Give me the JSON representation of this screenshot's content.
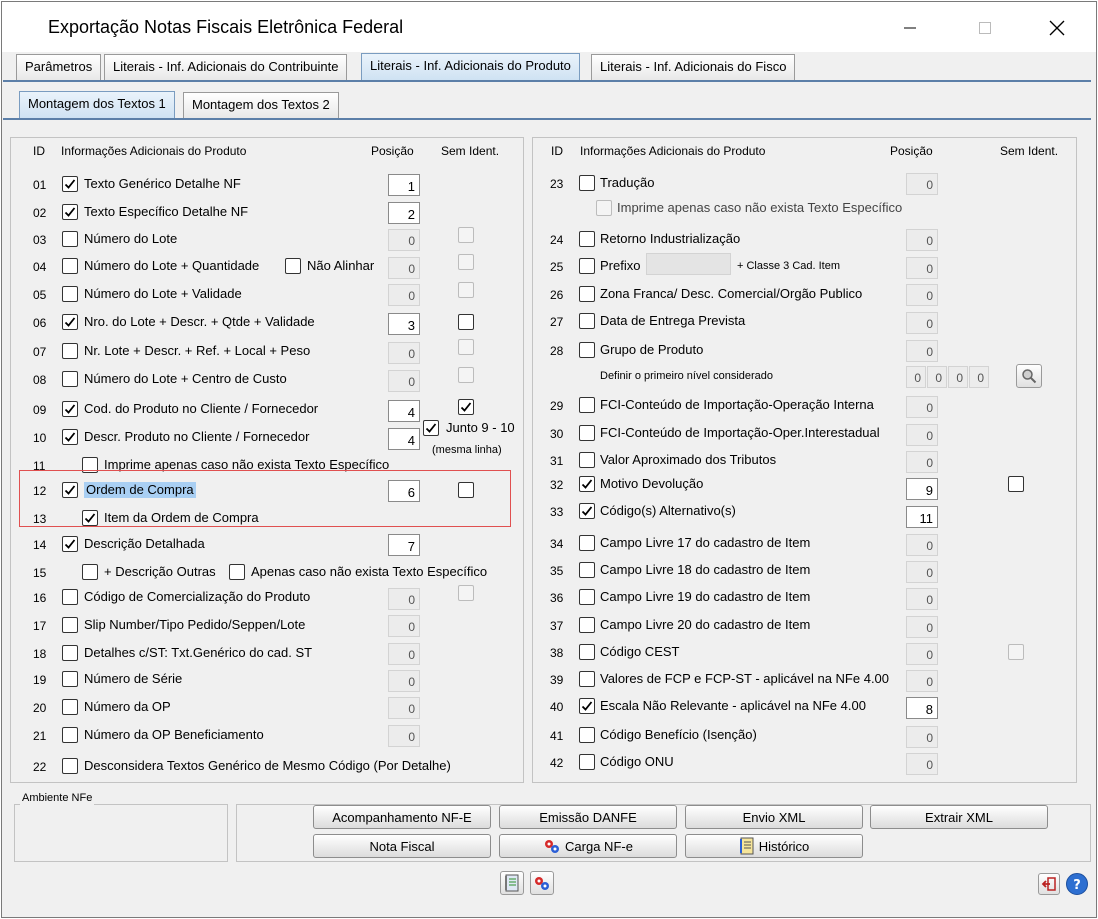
{
  "window": {
    "title": "Exportação Notas Fiscais Eletrônica Federal"
  },
  "tabs": [
    {
      "label": "Parâmetros",
      "active": false
    },
    {
      "label": "Literais - Inf. Adicionais do Contribuinte",
      "active": false
    },
    {
      "label": "Literais - Inf. Adicionais do Produto",
      "active": true
    },
    {
      "label": "Literais - Inf. Adicionais do Fisco",
      "active": false
    }
  ],
  "subtabs": [
    {
      "label": "Montagem dos Textos 1",
      "active": true
    },
    {
      "label": "Montagem dos Textos 2",
      "active": false
    }
  ],
  "headers": {
    "id": "ID",
    "info": "Informações Adicionais do Produto",
    "posicao": "Posição",
    "sem_ident": "Sem Ident."
  },
  "left": {
    "r01": {
      "id": "01",
      "label": "Texto Genérico Detalhe NF",
      "checked": true,
      "pos": "1"
    },
    "r02": {
      "id": "02",
      "label": "Texto Específico Detalhe NF",
      "checked": true,
      "pos": "2"
    },
    "r03": {
      "id": "03",
      "label": "Número do Lote",
      "checked": false,
      "pos": "0"
    },
    "r04": {
      "id": "04",
      "label": "Número do Lote + Quantidade",
      "checked": false,
      "pos": "0",
      "extra": "Não Alinhar"
    },
    "r05": {
      "id": "05",
      "label": "Número do Lote + Validade",
      "checked": false,
      "pos": "0"
    },
    "r06": {
      "id": "06",
      "label": "Nro. do Lote + Descr. + Qtde + Validade",
      "checked": true,
      "pos": "3"
    },
    "r07": {
      "id": "07",
      "label": "Nr. Lote + Descr. + Ref. + Local + Peso",
      "checked": false,
      "pos": "0"
    },
    "r08": {
      "id": "08",
      "label": "Número do Lote + Centro de Custo",
      "checked": false,
      "pos": "0"
    },
    "r09": {
      "id": "09",
      "label": "Cod. do Produto no Cliente / Fornecedor",
      "checked": true,
      "pos": "4"
    },
    "r10": {
      "id": "10",
      "label": "Descr. Produto no Cliente / Fornecedor",
      "checked": true,
      "pos": "4",
      "junto": "Junto 9 - 10",
      "mesma": "(mesma linha)"
    },
    "r11": {
      "id": "11",
      "label": "Imprime apenas caso não exista Texto Específico",
      "checked": false
    },
    "r12": {
      "id": "12",
      "label": "Ordem de Compra",
      "checked": true,
      "pos": "6"
    },
    "r13": {
      "id": "13",
      "label": "Item da Ordem de Compra",
      "checked": true
    },
    "r14": {
      "id": "14",
      "label": "Descrição Detalhada",
      "checked": true,
      "pos": "7"
    },
    "r15": {
      "id": "15",
      "label": "+ Descrição Outras",
      "checked": false,
      "extra": "Apenas caso não exista Texto Específico"
    },
    "r16": {
      "id": "16",
      "label": "Código de Comercialização do Produto",
      "checked": false,
      "pos": "0"
    },
    "r17": {
      "id": "17",
      "label": "Slip Number/Tipo Pedido/Seppen/Lote",
      "checked": false,
      "pos": "0"
    },
    "r18": {
      "id": "18",
      "label": "Detalhes c/ST: Txt.Genérico do cad. ST",
      "checked": false,
      "pos": "0"
    },
    "r19": {
      "id": "19",
      "label": "Número de Série",
      "checked": false,
      "pos": "0"
    },
    "r20": {
      "id": "20",
      "label": "Número da OP",
      "checked": false,
      "pos": "0"
    },
    "r21": {
      "id": "21",
      "label": "Número da OP Beneficiamento",
      "checked": false,
      "pos": "0"
    },
    "r22": {
      "id": "22",
      "label": "Desconsidera Textos Genérico de Mesmo Código (Por Detalhe)",
      "checked": false
    }
  },
  "right": {
    "r23": {
      "id": "23",
      "label": "Tradução",
      "checked": false,
      "pos": "0",
      "sub": "Imprime apenas caso não exista Texto Específico"
    },
    "r24": {
      "id": "24",
      "label": "Retorno Industrialização",
      "checked": false,
      "pos": "0"
    },
    "r25": {
      "id": "25",
      "label": "Prefixo",
      "checked": false,
      "pos": "0",
      "extra": "+ Classe 3 Cad. Item"
    },
    "r26": {
      "id": "26",
      "label": "Zona Franca/ Desc. Comercial/Orgão Publico",
      "checked": false,
      "pos": "0"
    },
    "r27": {
      "id": "27",
      "label": "Data de Entrega Prevista",
      "checked": false,
      "pos": "0"
    },
    "r28": {
      "id": "28",
      "label": "Grupo de Produto",
      "checked": false,
      "pos": "0",
      "sub": "Definir o primeiro nível considerado",
      "levels": [
        "0",
        "0",
        "0",
        "0"
      ]
    },
    "r29": {
      "id": "29",
      "label": "FCI-Conteúdo de Importação-Operação Interna",
      "checked": false,
      "pos": "0"
    },
    "r30": {
      "id": "30",
      "label": "FCI-Conteúdo de Importação-Oper.Interestadual",
      "checked": false,
      "pos": "0"
    },
    "r31": {
      "id": "31",
      "label": "Valor Aproximado dos Tributos",
      "checked": false,
      "pos": "0"
    },
    "r32": {
      "id": "32",
      "label": "Motivo Devolução",
      "checked": true,
      "pos": "9"
    },
    "r33": {
      "id": "33",
      "label": "Código(s) Alternativo(s)",
      "checked": true,
      "pos": "11"
    },
    "r34": {
      "id": "34",
      "label": "Campo Livre 17 do cadastro de Item",
      "checked": false,
      "pos": "0"
    },
    "r35": {
      "id": "35",
      "label": "Campo Livre 18 do cadastro de Item",
      "checked": false,
      "pos": "0"
    },
    "r36": {
      "id": "36",
      "label": "Campo Livre 19 do cadastro de Item",
      "checked": false,
      "pos": "0"
    },
    "r37": {
      "id": "37",
      "label": "Campo Livre 20 do cadastro de Item",
      "checked": false,
      "pos": "0"
    },
    "r38": {
      "id": "38",
      "label": "Código CEST",
      "checked": false,
      "pos": "0"
    },
    "r39": {
      "id": "39",
      "label": "Valores de FCP e FCP-ST - aplicável na NFe 4.00",
      "checked": false,
      "pos": "0"
    },
    "r40": {
      "id": "40",
      "label": "Escala Não Relevante - aplicável na NFe 4.00",
      "checked": true,
      "pos": "8"
    },
    "r41": {
      "id": "41",
      "label": "Código Benefício (Isenção)",
      "checked": false,
      "pos": "0"
    },
    "r42": {
      "id": "42",
      "label": "Código ONU",
      "checked": false,
      "pos": "0"
    }
  },
  "ambiente": {
    "label": "Ambiente NFe"
  },
  "buttons": {
    "acompanhamento": "Acompanhamento NF-E",
    "emissao": "Emissão DANFE",
    "envio": "Envio XML",
    "extrair": "Extrair XML",
    "nota": "Nota Fiscal",
    "carga": "Carga NF-e",
    "historico": "Histórico"
  },
  "colors": {
    "accent_tab": "#cfe2f3",
    "highlight": "#a9cff3",
    "red_box": "#e05050"
  }
}
